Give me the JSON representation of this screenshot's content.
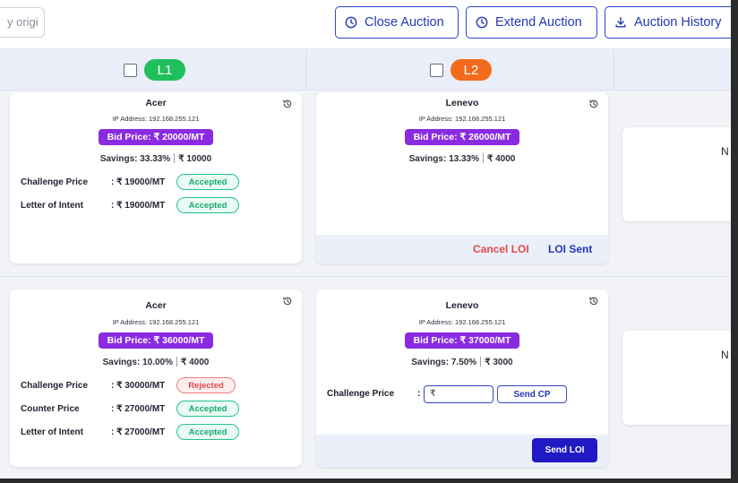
{
  "topbar": {
    "search_value": "y origi",
    "close_label": "Close Auction",
    "extend_label": "Extend Auction",
    "history_label": "Auction History"
  },
  "columns": [
    {
      "rank": "L1",
      "color": "#1fbf5b"
    },
    {
      "rank": "L2",
      "color": "#f26b1d"
    }
  ],
  "rows": [
    {
      "cards": [
        {
          "name": "Acer",
          "ip": "IP Address: 192.168.255.121",
          "bid": "Bid Price: ₹ 20000/MT",
          "savings_pct": "Savings: 33.33%",
          "savings_amt": "₹ 10000",
          "lines": [
            {
              "label": "Challenge Price",
              "value": ": ₹ 19000/MT",
              "status": "Accepted"
            },
            {
              "label": "Letter of Intent",
              "value": ": ₹ 19000/MT",
              "status": "Accepted"
            }
          ]
        },
        {
          "name": "Lenevo",
          "ip": "IP Address: 192.168.255.121",
          "bid": "Bid Price: ₹ 26000/MT",
          "savings_pct": "Savings: 13.33%",
          "savings_amt": "₹ 4000",
          "footer": {
            "cancel": "Cancel LOI",
            "sent": "LOI Sent"
          }
        }
      ],
      "partial_text": "N"
    },
    {
      "cards": [
        {
          "name": "Acer",
          "ip": "IP Address: 192.168.255.121",
          "bid": "Bid Price: ₹ 36000/MT",
          "savings_pct": "Savings: 10.00%",
          "savings_amt": "₹ 4000",
          "lines": [
            {
              "label": "Challenge Price",
              "value": ": ₹ 30000/MT",
              "status": "Rejected"
            },
            {
              "label": "Counter Price",
              "value": ": ₹ 27000/MT",
              "status": "Accepted"
            },
            {
              "label": "Letter of Intent",
              "value": ": ₹ 27000/MT",
              "status": "Accepted"
            }
          ]
        },
        {
          "name": "Lenevo",
          "ip": "IP Address: 192.168.255.121",
          "bid": "Bid Price: ₹ 37000/MT",
          "savings_pct": "Savings: 7.50%",
          "savings_amt": "₹ 3000",
          "challenge_label": "Challenge Price",
          "challenge_colon": ":",
          "challenge_value": "₹",
          "send_cp": "Send CP",
          "send_loi": "Send LOI"
        }
      ],
      "partial_text": "N"
    }
  ],
  "icons": {
    "history": "history-icon",
    "clock": "clock-icon",
    "download": "download-icon"
  }
}
